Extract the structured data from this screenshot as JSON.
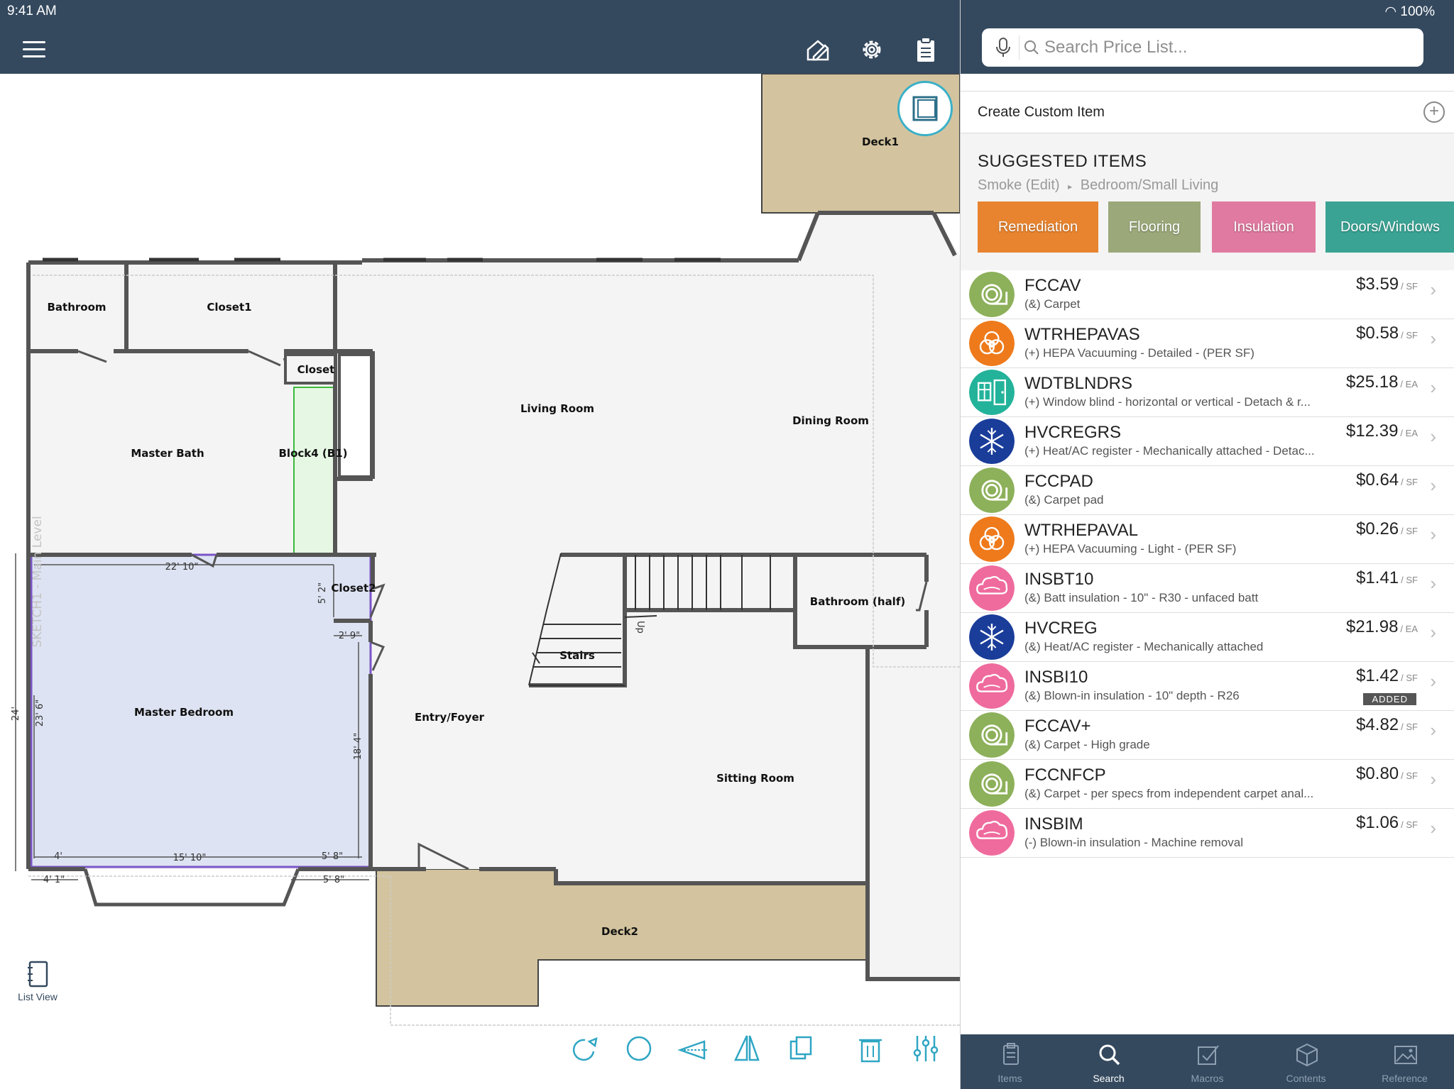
{
  "status": {
    "time": "9:41 AM",
    "battery": "100%"
  },
  "canvas": {
    "rooms": {
      "deck1": "Deck1",
      "bathroom": "Bathroom",
      "closet1": "Closet1",
      "closet": "Closet",
      "living_room": "Living Room",
      "dining_room": "Dining Room",
      "master_bath": "Master Bath",
      "block4": "Block4 (B1)",
      "closet2": "Closet2",
      "bathroom_half": "Bathroom (half)",
      "stairs": "Stairs",
      "master_bedroom": "Master Bedroom",
      "entry_foyer": "Entry/Foyer",
      "sitting_room": "Sitting Room",
      "deck2": "Deck2"
    },
    "dimensions": {
      "d1": "22' 10\"",
      "d2": "5' 2\"",
      "d3": "2' 9\"",
      "d4": "23' 6\"",
      "d5": "24'",
      "d6": "18' 4\"",
      "d7": "4'",
      "d8": "15' 10\"",
      "d9": "5' 8\"",
      "d10": "4' 1\"",
      "d11": "5' 8\""
    },
    "level_label": "SKETCH1 - Main Level",
    "up_label": "Up",
    "list_view_label": "List View"
  },
  "panel": {
    "search_placeholder": "Search Price List...",
    "create_custom_label": "Create Custom Item",
    "suggested_title": "SUGGESTED ITEMS",
    "breadcrumb": {
      "a": "Smoke (Edit)",
      "sep": "▸",
      "b": "Bedroom/Small Living"
    },
    "categories": [
      {
        "label": "Remediation",
        "color": "#e8842f"
      },
      {
        "label": "Flooring",
        "color": "#9ba87a"
      },
      {
        "label": "Insulation",
        "color": "#e07aa0"
      },
      {
        "label": "Doors/Windows",
        "color": "#3aa394"
      }
    ],
    "items": [
      {
        "code": "FCCAV",
        "desc": "(&) Carpet",
        "price": "$3.59",
        "unit": "SF",
        "icon": "carpet-icon",
        "color": "#8db05a"
      },
      {
        "code": "WTRHEPAVAS",
        "desc": "(+) HEPA Vacuuming - Detailed - (PER SF)",
        "price": "$0.58",
        "unit": "SF",
        "icon": "biohazard-icon",
        "color": "#ee7a1c"
      },
      {
        "code": "WDTBLNDRS",
        "desc": "(+) Window blind - horizontal or vertical - Detach & r...",
        "price": "$25.18",
        "unit": "EA",
        "icon": "window-door-icon",
        "color": "#23b39a"
      },
      {
        "code": "HVCREGRS",
        "desc": "(+) Heat/AC register - Mechanically attached - Detac...",
        "price": "$12.39",
        "unit": "EA",
        "icon": "snowflake-flame-icon",
        "color": "#1a3d9a"
      },
      {
        "code": "FCCPAD",
        "desc": "(&) Carpet pad",
        "price": "$0.64",
        "unit": "SF",
        "icon": "carpet-icon",
        "color": "#8db05a"
      },
      {
        "code": "WTRHEPAVAL",
        "desc": "(+) HEPA Vacuuming - Light - (PER SF)",
        "price": "$0.26",
        "unit": "SF",
        "icon": "biohazard-icon",
        "color": "#ee7a1c"
      },
      {
        "code": "INSBT10",
        "desc": "(&) Batt insulation - 10\" - R30 - unfaced batt",
        "price": "$1.41",
        "unit": "SF",
        "icon": "insulation-cloud-icon",
        "color": "#ef6b9d"
      },
      {
        "code": "HVCREG",
        "desc": "(&) Heat/AC register - Mechanically attached",
        "price": "$21.98",
        "unit": "EA",
        "icon": "snowflake-flame-icon",
        "color": "#1a3d9a"
      },
      {
        "code": "INSBI10",
        "desc": "(&) Blown-in insulation - 10\" depth - R26",
        "price": "$1.42",
        "unit": "SF",
        "icon": "insulation-cloud-icon",
        "color": "#ef6b9d",
        "badge": "ADDED"
      },
      {
        "code": "FCCAV+",
        "desc": "(&) Carpet - High grade",
        "price": "$4.82",
        "unit": "SF",
        "icon": "carpet-icon",
        "color": "#8db05a"
      },
      {
        "code": "FCCNFCP",
        "desc": "(&) Carpet - per specs from independent carpet anal...",
        "price": "$0.80",
        "unit": "SF",
        "icon": "carpet-icon",
        "color": "#8db05a"
      },
      {
        "code": "INSBIM",
        "desc": "(-) Blown-in insulation - Machine removal",
        "price": "$1.06",
        "unit": "SF",
        "icon": "insulation-cloud-icon",
        "color": "#ef6b9d"
      }
    ],
    "tabs": [
      {
        "label": "Items",
        "icon": "clipboard-icon"
      },
      {
        "label": "Search",
        "icon": "search-icon",
        "active": true
      },
      {
        "label": "Macros",
        "icon": "checkbox-icon"
      },
      {
        "label": "Contents",
        "icon": "box-icon"
      },
      {
        "label": "Reference",
        "icon": "image-icon"
      }
    ]
  }
}
